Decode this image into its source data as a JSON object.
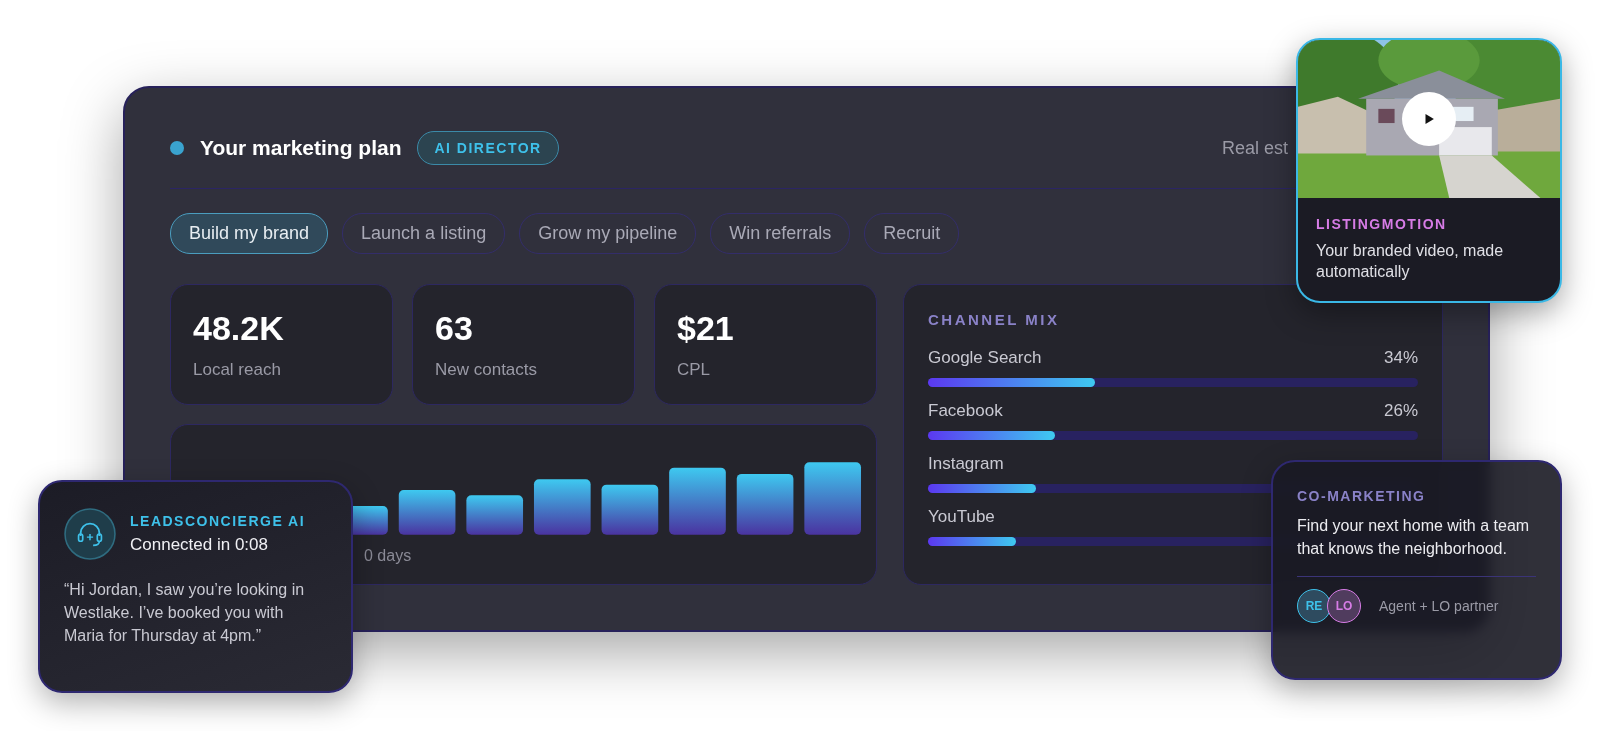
{
  "header": {
    "title": "Your marketing plan",
    "badge": "AI DIRECTOR",
    "subtitle": "Real est"
  },
  "goals": [
    {
      "label": "Build my brand",
      "selected": true
    },
    {
      "label": "Launch a listing",
      "selected": false
    },
    {
      "label": "Grow my pipeline",
      "selected": false
    },
    {
      "label": "Win referrals",
      "selected": false
    },
    {
      "label": "Recruit",
      "selected": false
    }
  ],
  "stats": [
    {
      "value": "48.2K",
      "label": "Local reach"
    },
    {
      "value": "63",
      "label": "New contacts"
    },
    {
      "value": "$21",
      "label": "CPL"
    }
  ],
  "contacts_chart": {
    "caption": "0 days"
  },
  "channel_mix": {
    "title": "CHANNEL MIX",
    "channels": [
      {
        "name": "Google Search",
        "reading": "34%",
        "level": 0.34
      },
      {
        "name": "Facebook",
        "reading": "26%",
        "level": 0.26
      },
      {
        "name": "Instagram",
        "level": 0.22
      },
      {
        "name": "YouTube",
        "level": 0.18
      }
    ]
  },
  "concierge": {
    "title": "LEADSCONCIERGE AI",
    "status": "Connected in 0:08",
    "message": "“Hi Jordan, I saw you’re looking in Westlake. I’ve booked you with Maria for Thursday at 4pm.”"
  },
  "listing_video": {
    "title": "LISTINGMOTION",
    "text": "Your branded video, made automatically"
  },
  "co_marketing": {
    "title": "CO-MARKETING",
    "text": "Find your next home with a team that knows the neighborhood.",
    "avatars": [
      {
        "initials": "RE",
        "color": "#3ec1ea"
      },
      {
        "initials": "LO",
        "color": "#d77ce6"
      }
    ],
    "caption": "Agent + LO partner"
  }
}
